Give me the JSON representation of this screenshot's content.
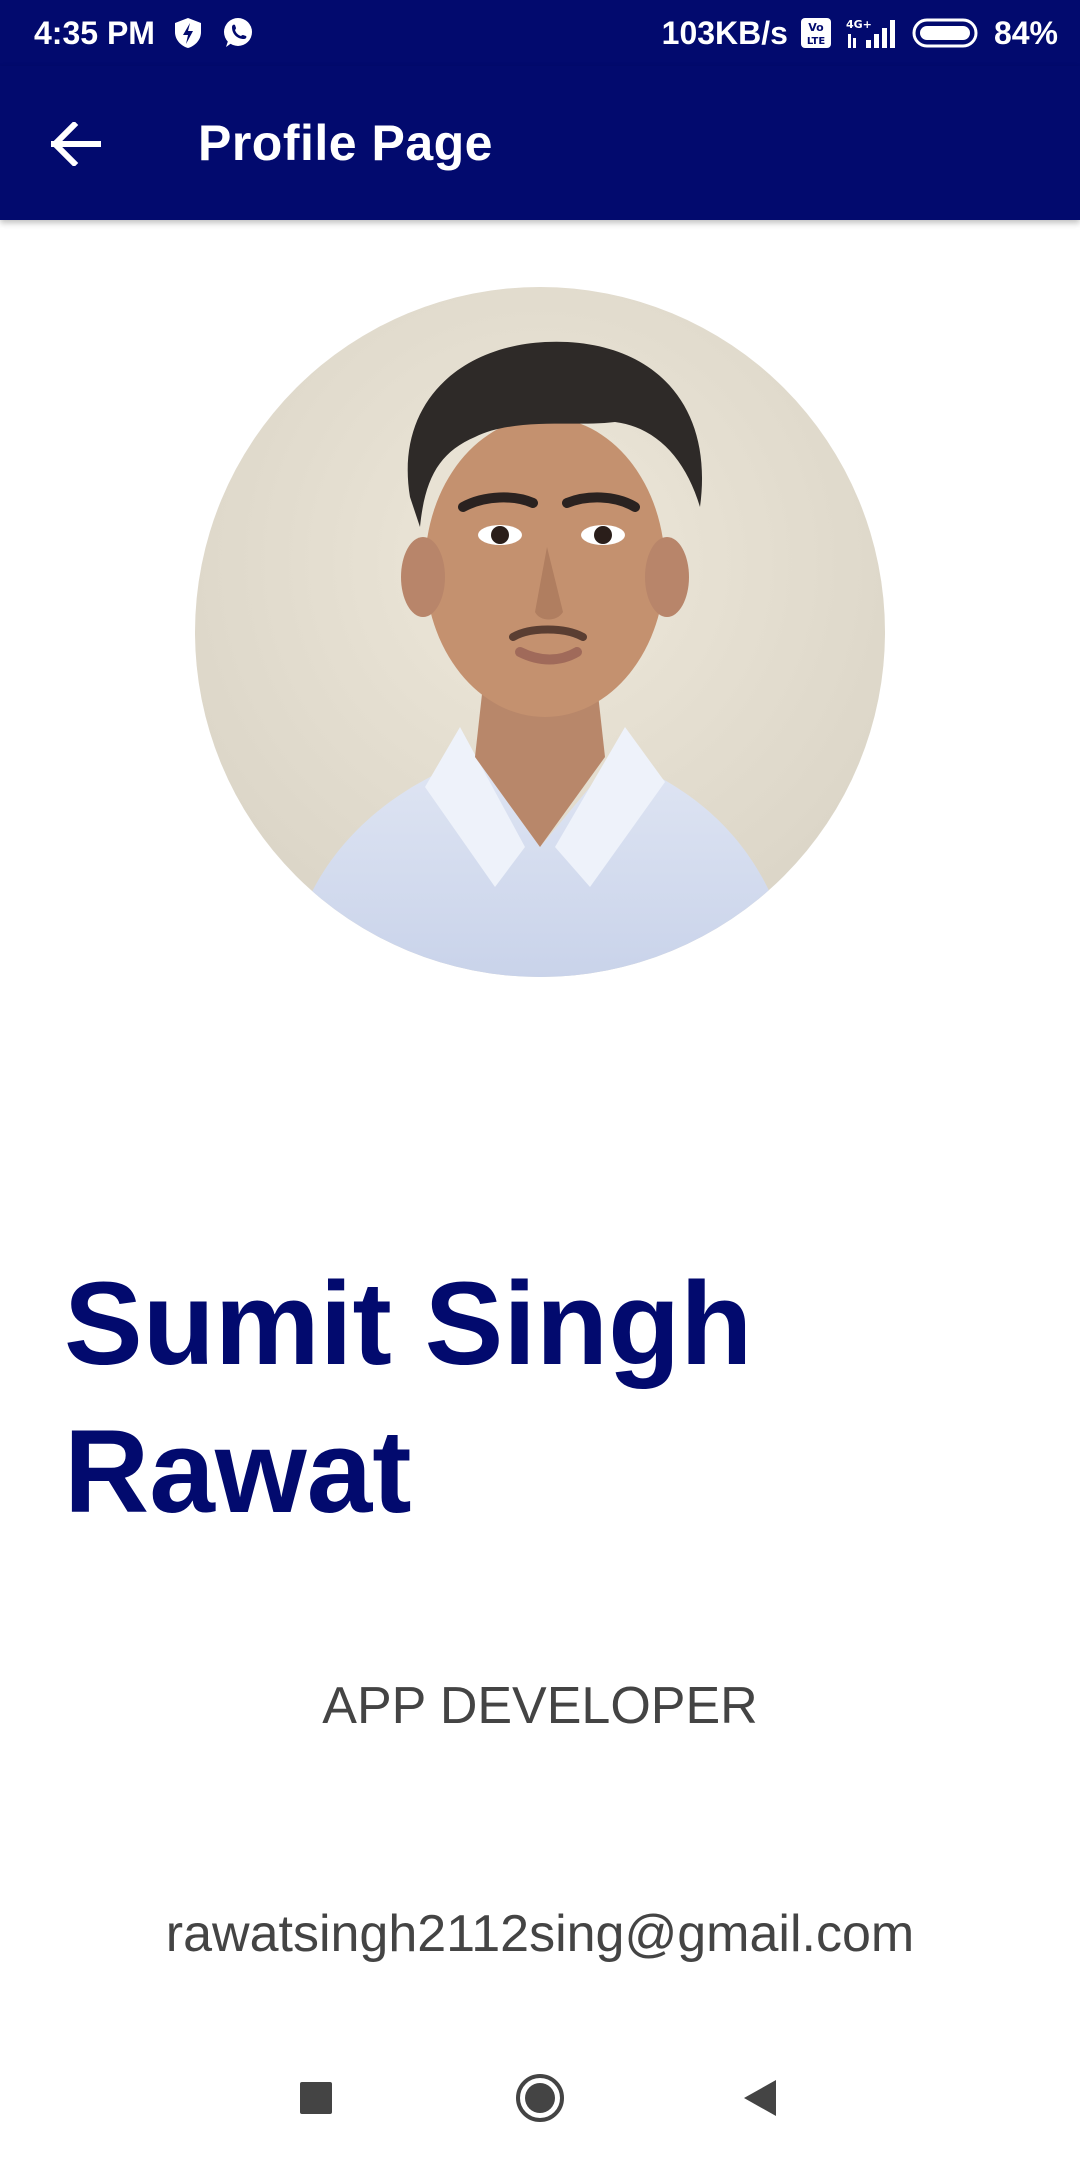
{
  "status_bar": {
    "time": "4:35 PM",
    "network_speed": "103KB/s",
    "volte": "Vo LTE",
    "network_type": "4G+",
    "battery": "84%",
    "icons": [
      "shield-bolt-icon",
      "whatsapp-icon",
      "volte-icon",
      "signal-icon",
      "battery-icon"
    ]
  },
  "app_bar": {
    "title": "Profile Page",
    "back_icon": "arrow-left-icon"
  },
  "profile": {
    "avatar": "profile-photo",
    "name": "Sumit Singh Rawat",
    "role": "APP DEVELOPER",
    "email": "rawatsingh2112sing@gmail.com"
  },
  "nav_bar": {
    "icons": [
      "recents-square-icon",
      "home-circle-icon",
      "back-triangle-icon"
    ]
  },
  "colors": {
    "primary": "#020a6e",
    "text_secondary": "#444444",
    "background": "#ffffff"
  }
}
